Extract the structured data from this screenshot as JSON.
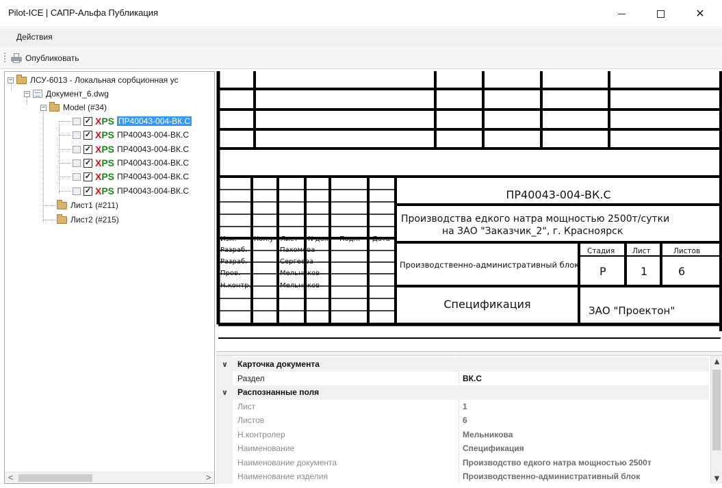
{
  "window": {
    "title": "Pilot-ICE | САПР-Альфа Публикация",
    "minimize_icon": "minimize-icon",
    "maximize_icon": "maximize-icon",
    "close_icon": "close-icon",
    "close_glyph": "✕"
  },
  "menu": {
    "actions_label": "Действия"
  },
  "toolbar": {
    "publish_label": "Опубликовать",
    "publish_icon": "printer-icon"
  },
  "tree": {
    "root": {
      "label": "ЛСУ-6013 - Локальная сорбционная ус",
      "expander": "−"
    },
    "document": {
      "label": "Документ_6.dwg",
      "expander": "−"
    },
    "model": {
      "label": "Model (#34)",
      "expander": "−"
    },
    "model_items": [
      {
        "x_text": "X",
        "ps_text": "PS",
        "label": "ПР40043-004-ВК.С",
        "checked": "✓",
        "selected": true
      },
      {
        "x_text": "X",
        "ps_text": "PS",
        "label": "ПР40043-004-ВК.С",
        "checked": "✓",
        "selected": false
      },
      {
        "x_text": "X",
        "ps_text": "PS",
        "label": "ПР40043-004-ВК.С",
        "checked": "✓",
        "selected": false
      },
      {
        "x_text": "X",
        "ps_text": "PS",
        "label": "ПР40043-004-ВК.С",
        "checked": "✓",
        "selected": false
      },
      {
        "x_text": "X",
        "ps_text": "PS",
        "label": "ПР40043-004-ВК.С",
        "checked": "✓",
        "selected": false
      },
      {
        "x_text": "X",
        "ps_text": "PS",
        "label": "ПР40043-004-ВК.С",
        "checked": "✓",
        "selected": false
      }
    ],
    "sheet1": {
      "label": "Лист1 (#211)"
    },
    "sheet2": {
      "label": "Лист2 (#215)"
    },
    "scroll_left": "<",
    "scroll_right": ">"
  },
  "drawing": {
    "code": "ПР40043-004-ВК.С",
    "project_line1": "Производства едкого натра мощностью 2500т/сутки",
    "project_line2": "на ЗАО \"Заказчик_2\", г. Красноярск",
    "header": [
      "Изм.",
      "Кол.уч",
      "Лист",
      "N док.",
      "Подп.",
      "Дата"
    ],
    "roles": [
      {
        "role": "Разраб.",
        "name": "Пахомова"
      },
      {
        "role": "Разраб.",
        "name": "Сергеева"
      },
      {
        "role": "Пров.",
        "name": "Мельников"
      },
      {
        "role": "Н.контр.",
        "name": "Мельников"
      }
    ],
    "block_name": "Производственно-административный блок",
    "stage_label": "Стадия",
    "sheet_label": "Лист",
    "sheets_label": "Листов",
    "stage_value": "Р",
    "sheet_value": "1",
    "sheets_value": "6",
    "doc_title": "Спецификация",
    "company": "ЗАО \"Проектон\""
  },
  "properties": {
    "cat_card": {
      "label": "Карточка документа",
      "chevron": "∨"
    },
    "section": {
      "name": "Раздел",
      "value": "ВК.С"
    },
    "cat_recognized": {
      "label": "Распознанные поля",
      "chevron": "∨"
    },
    "rows": [
      {
        "name": "Лист",
        "value": "1"
      },
      {
        "name": "Листов",
        "value": "6"
      },
      {
        "name": "Н.контролер",
        "value": "Мельникова"
      },
      {
        "name": "Наименование",
        "value": "Спецификация"
      },
      {
        "name": "Наименование документа",
        "value": "Производство едкого натра мощностью 2500т"
      },
      {
        "name": "Наименование изделия",
        "value": "Производственно-административный блок"
      }
    ],
    "scroll_up": "▲",
    "scroll_down": "▼"
  }
}
